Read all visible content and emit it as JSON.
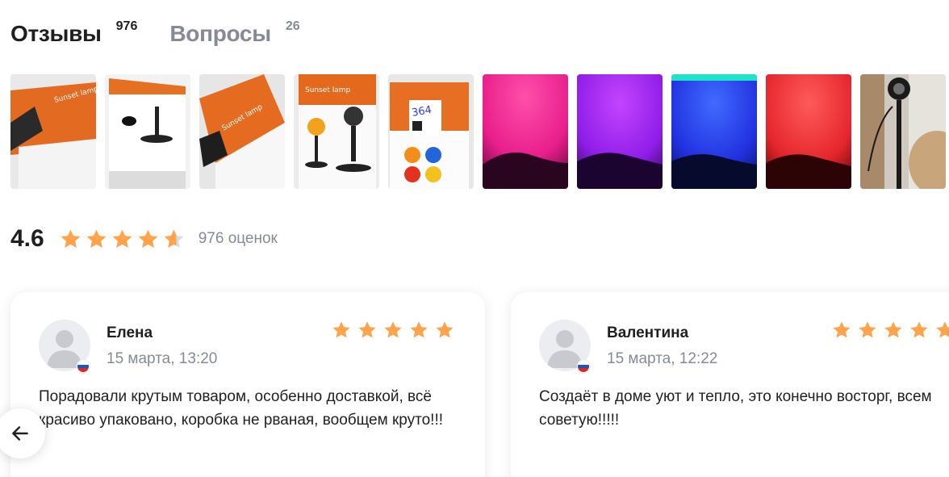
{
  "tabs": [
    {
      "label": "Отзывы",
      "count": "976",
      "active": true
    },
    {
      "label": "Вопросы",
      "count": "26",
      "active": false
    }
  ],
  "photos": [
    {
      "name": "photo-box-open-1"
    },
    {
      "name": "photo-box-inside"
    },
    {
      "name": "photo-box-open-2"
    },
    {
      "name": "photo-box-front"
    },
    {
      "name": "photo-box-back"
    },
    {
      "name": "photo-pink-light"
    },
    {
      "name": "photo-purple-light"
    },
    {
      "name": "photo-blue-light"
    },
    {
      "name": "photo-red-light"
    },
    {
      "name": "photo-lamp-room"
    }
  ],
  "rating": {
    "value": "4.6",
    "stars_fraction": 0.92,
    "count_text": "976 оценок"
  },
  "colors": {
    "star": "#ffa44b",
    "star_empty": "#d9dbe0",
    "muted": "#858a96"
  },
  "reviews": [
    {
      "author": "Елена",
      "date": "15 марта, 13:20",
      "stars": 5,
      "text": "Порадовали крутым товаром, особенно доставкой, всё красиво упаковано, коробка не рваная, вообщем круто!!!"
    },
    {
      "author": "Валентина",
      "date": "15 марта, 12:22",
      "stars": 5,
      "text": "Создаёт в доме уют и тепло, это конечно восторг, всем советую!!!!!"
    }
  ],
  "icons": {
    "nav": "arrow-left-icon",
    "star": "star-icon",
    "avatar": "user-avatar-icon",
    "flag": "russia-flag-icon"
  }
}
